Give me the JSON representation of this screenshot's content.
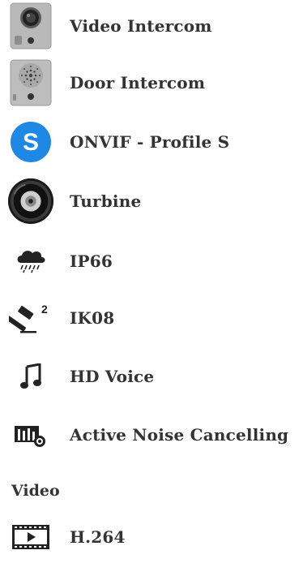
{
  "features": [
    {
      "label": "Video Intercom",
      "icon": "video-intercom-icon"
    },
    {
      "label": "Door Intercom",
      "icon": "door-intercom-icon"
    },
    {
      "label": "ONVIF - Profile S",
      "icon": "onvif-s-icon",
      "icon_text": "S",
      "icon_color": "#1e88e5"
    },
    {
      "label": "Turbine",
      "icon": "turbine-speaker-icon"
    },
    {
      "label": "IP66",
      "icon": "rain-cloud-icon"
    },
    {
      "label": "IK08",
      "icon": "hammer-icon",
      "icon_text": "2"
    },
    {
      "label": "HD Voice",
      "icon": "music-note-icon"
    },
    {
      "label": "Active Noise Cancelling",
      "icon": "noise-cancelling-icon"
    }
  ],
  "section": {
    "title": "Video"
  },
  "video_features": [
    {
      "label": "H.264",
      "icon": "video-play-icon"
    }
  ]
}
